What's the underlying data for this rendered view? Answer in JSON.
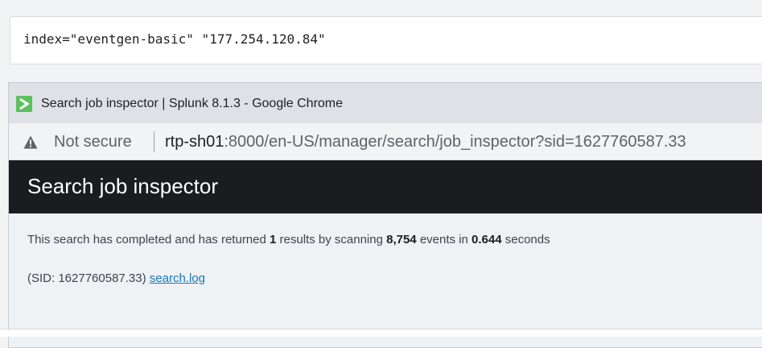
{
  "search": {
    "query": "index=\"eventgen-basic\" \"177.254.120.84\""
  },
  "window": {
    "title": "Search job inspector | Splunk 8.1.3 - Google Chrome",
    "app_icon": "terminal-prompt-icon"
  },
  "address_bar": {
    "warning_icon": "warning-triangle-icon",
    "security_label": "Not secure",
    "url_host": "rtp-sh01",
    "url_rest": ":8000/en-US/manager/search/job_inspector?sid=1627760587.33"
  },
  "page": {
    "title": "Search job inspector",
    "status": {
      "prefix": "This search has completed and has returned ",
      "result_count": "1",
      "middle": " results by scanning ",
      "event_count": "8,754",
      "events_word": " events in ",
      "duration": "0.644",
      "suffix": " seconds"
    },
    "sid_label": "(SID: 1627760587.33)",
    "log_link": "search.log"
  },
  "colors": {
    "header_bg": "#1a1c20",
    "body_bg": "#eef2f5",
    "link": "#1a76b6",
    "app_icon": "#5cc05c"
  }
}
